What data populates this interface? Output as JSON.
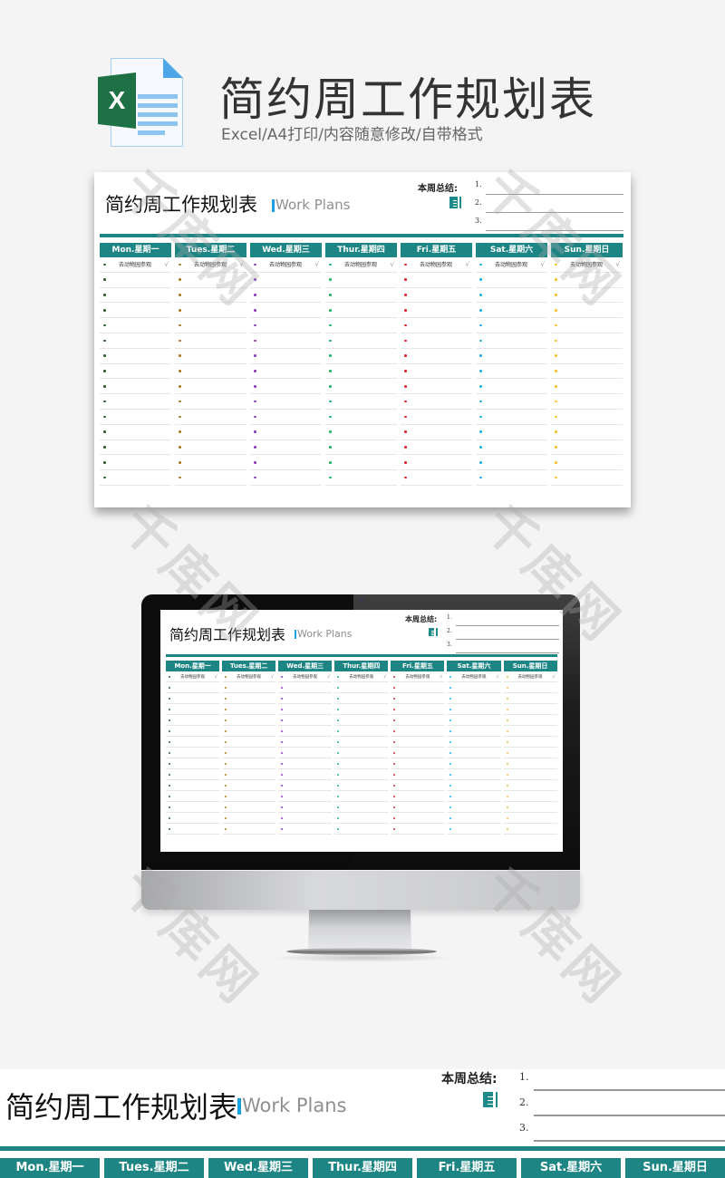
{
  "header": {
    "icon": "excel-file-icon",
    "icon_letter": "X",
    "title": "简约周工作规划表",
    "subtitle": "Excel/A4打印/内容随意修改/自带格式"
  },
  "sheet": {
    "title": "简约周工作规划表",
    "english_title": "Work Plans",
    "summary_label": "本周总结:",
    "summary_icon": "notebook-pen-icon",
    "summary_items": [
      "1.",
      "2.",
      "3."
    ],
    "days": [
      {
        "label": "Mon.星期一",
        "dot_color": "#2e5e2e"
      },
      {
        "label": "Tues.星期二",
        "dot_color": "#a87a22"
      },
      {
        "label": "Wed.星期三",
        "dot_color": "#8a3fc0"
      },
      {
        "label": "Thur.星期四",
        "dot_color": "#1db36a"
      },
      {
        "label": "Fri.星期五",
        "dot_color": "#e0262e"
      },
      {
        "label": "Sat.星期六",
        "dot_color": "#1fb2e6"
      },
      {
        "label": "Sun.星期日",
        "dot_color": "#f5c22a"
      }
    ],
    "example_task": "去动物园参观",
    "example_check": "√",
    "empty_rows": 14
  },
  "colors": {
    "accent_teal": "#1e8585",
    "english_bar": "#1aa0e0",
    "excel_green": "#1e7145"
  },
  "watermark": "千库网"
}
